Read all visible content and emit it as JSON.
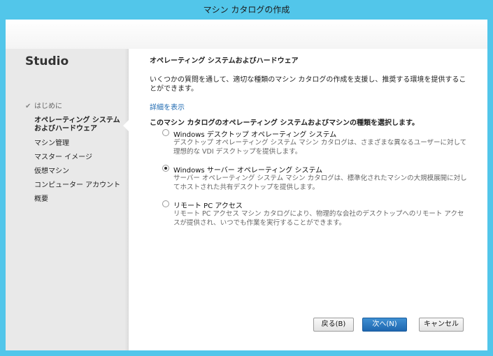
{
  "window": {
    "title": "マシン カタログの作成"
  },
  "sidebar": {
    "app_name": "Studio",
    "items": [
      {
        "label": "はじめに",
        "state": "done"
      },
      {
        "label_line1": "オペレーティング システム",
        "label_line2": "およびハードウェア",
        "state": "current"
      },
      {
        "label": "マシン管理"
      },
      {
        "label": "マスター イメージ"
      },
      {
        "label": "仮想マシン"
      },
      {
        "label": "コンピューター アカウント"
      },
      {
        "label": "概要"
      }
    ]
  },
  "main": {
    "section_title": "オペレーティング システムおよびハードウェア",
    "intro": "いくつかの質問を通して、適切な種類のマシン カタログの作成を支援し、推奨する環境を提供することができます。",
    "details_link": "詳細を表示",
    "question": "このマシン カタログのオペレーティング システムおよびマシンの種類を選択します。",
    "options": [
      {
        "label": "Windows デスクトップ オペレーティング システム",
        "description": "デスクトップ オペレーティング システム マシン カタログは、さまざまな異なるユーザーに対して理想的な VDI デスクトップを提供します。",
        "selected": false
      },
      {
        "label": "Windows サーバー オペレーティング システム",
        "description": "サーバー オペレーティング システム マシン カタログは、標準化されたマシンの大規模展開に対してホストされた共有デスクトップを提供します。",
        "selected": true
      },
      {
        "label": "リモート PC アクセス",
        "description": "リモート PC アクセス マシン カタログにより、物理的な会社のデスクトップへのリモート アクセスが提供され、いつでも作業を実行することができます。",
        "selected": false
      }
    ]
  },
  "buttons": {
    "back": "戻る(B)",
    "next": "次へ(N)",
    "cancel": "キャンセル"
  },
  "colors": {
    "frame": "#52c6ea",
    "link": "#1f6ab1",
    "primary_button": "#1e67b0"
  }
}
